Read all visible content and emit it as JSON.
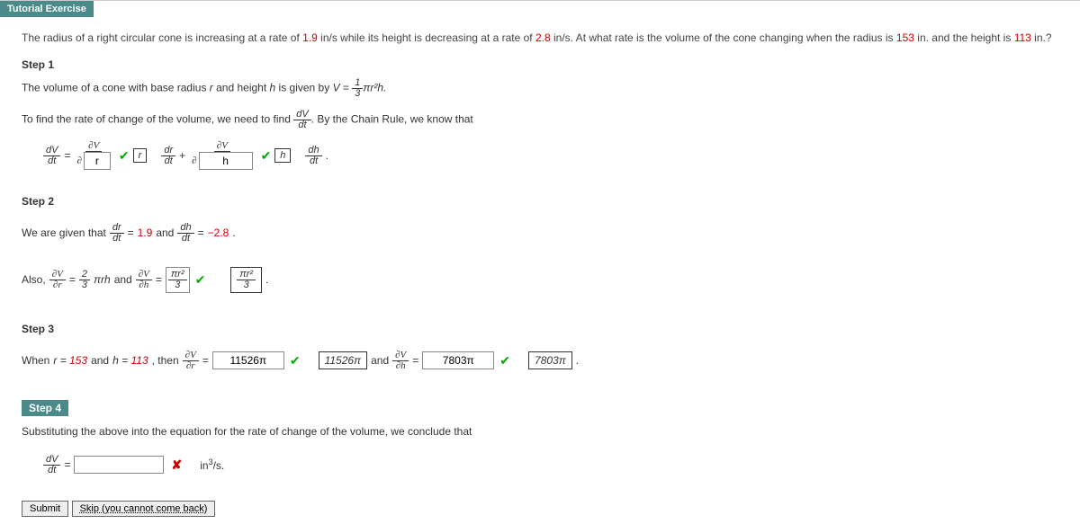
{
  "header": {
    "title": "Tutorial Exercise"
  },
  "question": {
    "pre": "The radius of a right circular cone is increasing at a rate of ",
    "rate1": "1.9",
    "mid1": " in/s while its height is decreasing at a rate of ",
    "rate2": "2.8",
    "mid2": " in/s. At what rate is the volume of the cone changing when the radius is ",
    "radius": "153",
    "mid3": " in. and the height is ",
    "height": "113",
    "end": " in.?"
  },
  "step1": {
    "title": "Step 1",
    "line1_a": "The volume of a cone with base radius ",
    "line1_b": " and height ",
    "line1_c": " is given by ",
    "formula_top": "1",
    "formula_bot": "3",
    "formula_rest": "πr²h.",
    "line2_a": "To find the rate of change of the volume, we need to find ",
    "line2_b": ". By the Chain Rule, we know that",
    "dV": "dV",
    "dt": "dt",
    "dr": "dr",
    "dh": "dh",
    "pV": "∂V",
    "pr": "∂",
    "ph": "∂",
    "input_r": "r",
    "input_h": "h",
    "box_r": "r",
    "box_h": "h",
    "plus": "+"
  },
  "step2": {
    "title": "Step 2",
    "given_a": "We are given that ",
    "dr": "dr",
    "dt": "dt",
    "val1": "1.9",
    "and": " and ",
    "dh": "dh",
    "val2": "−2.8",
    "also": "Also, ",
    "pV": "∂V",
    "pr": "∂r",
    "ph": "∂h",
    "two": "2",
    "three": "3",
    "pirh": "πrh",
    "input_pr2": "πr²",
    "input_3": "3",
    "ans_top": "πr²",
    "ans_bot": "3"
  },
  "step3": {
    "title": "Step 3",
    "when_a": "When ",
    "r_eq": "r = 153",
    "and1": " and ",
    "h_eq": "h = 113",
    "then": ", then ",
    "pV": "∂V",
    "pr": "∂r",
    "ph": "∂h",
    "eq": " = ",
    "input1": "11526π",
    "ans1": "11526π",
    "and2": " and ",
    "input2": "7803π",
    "ans2": "7803π"
  },
  "step4": {
    "title": "Step 4",
    "line": "Substituting the above into the equation for the rate of change of the volume, we conclude that",
    "dV": "dV",
    "dt": "dt",
    "units": "in³/s.",
    "input": ""
  },
  "buttons": {
    "submit": "Submit",
    "skip": "Skip (you cannot come back)"
  }
}
